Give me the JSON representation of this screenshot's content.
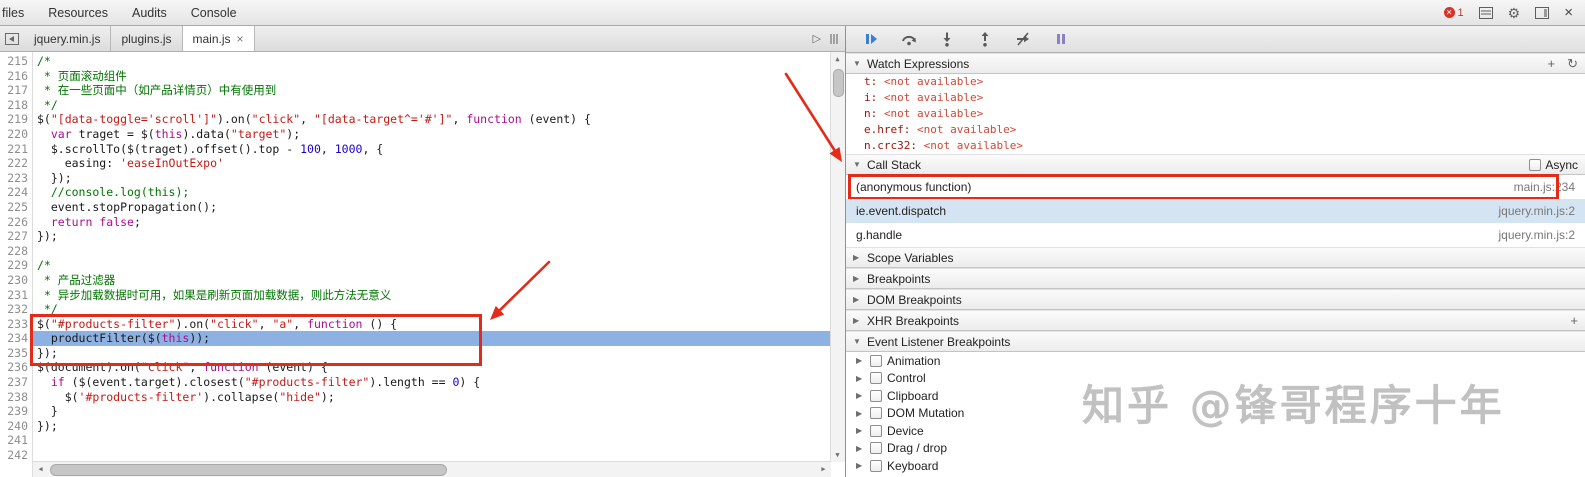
{
  "colors": {
    "annotation_red": "#e42a18",
    "execution_blue": "#8db1e3",
    "selection_blue": "#d5e4f3"
  },
  "icons": {
    "close": "×",
    "gear": "⚙",
    "refresh": "↻",
    "add": "+",
    "tri_right": "▶",
    "tri_down": "▼",
    "run": "▷",
    "err_x": "✕",
    "left": "◀",
    "right": "▶",
    "up": "▲",
    "down": "▼"
  },
  "top_bar": {
    "tabs": [
      "files",
      "Resources",
      "Audits",
      "Console"
    ],
    "error_count": "1"
  },
  "file_tab_bar": {
    "tabs": [
      {
        "label": "jquery.min.js",
        "active": false,
        "closable": false
      },
      {
        "label": "plugins.js",
        "active": false,
        "closable": false
      },
      {
        "label": "main.js",
        "active": true,
        "closable": true
      }
    ]
  },
  "editor": {
    "lines": [
      {
        "num": 215,
        "segs": [
          [
            "com",
            "/*"
          ]
        ]
      },
      {
        "num": 216,
        "segs": [
          [
            "com",
            " * 页面滚动组件"
          ]
        ]
      },
      {
        "num": 217,
        "segs": [
          [
            "com",
            " * 在一些页面中（如产品详情页）中有使用到"
          ]
        ]
      },
      {
        "num": 218,
        "segs": [
          [
            "com",
            " */"
          ]
        ]
      },
      {
        "num": 219,
        "segs": [
          [
            "pln",
            "$("
          ],
          [
            "str",
            "\"[data-toggle='scroll']\""
          ],
          [
            "pln",
            ").on("
          ],
          [
            "str",
            "\"click\""
          ],
          [
            "pln",
            ", "
          ],
          [
            "str",
            "\"[data-target^='#']\""
          ],
          [
            "pln",
            ", "
          ],
          [
            "kw",
            "function"
          ],
          [
            "pln",
            " (event) {"
          ]
        ]
      },
      {
        "num": 220,
        "segs": [
          [
            "pln",
            "  "
          ],
          [
            "kw",
            "var"
          ],
          [
            "pln",
            " traget = $("
          ],
          [
            "kw",
            "this"
          ],
          [
            "pln",
            ").data("
          ],
          [
            "str",
            "\"target\""
          ],
          [
            "pln",
            ");"
          ]
        ]
      },
      {
        "num": 221,
        "segs": [
          [
            "pln",
            "  $.scrollTo($(traget).offset().top - "
          ],
          [
            "num",
            "100"
          ],
          [
            "pln",
            ", "
          ],
          [
            "num",
            "1000"
          ],
          [
            "pln",
            ", {"
          ]
        ]
      },
      {
        "num": 222,
        "segs": [
          [
            "pln",
            "    easing: "
          ],
          [
            "str",
            "'easeInOutExpo'"
          ]
        ]
      },
      {
        "num": 223,
        "segs": [
          [
            "pln",
            "  });"
          ]
        ]
      },
      {
        "num": 224,
        "segs": [
          [
            "com",
            "  //console.log(this);"
          ]
        ]
      },
      {
        "num": 225,
        "segs": [
          [
            "pln",
            "  event.stopPropagation();"
          ]
        ]
      },
      {
        "num": 226,
        "segs": [
          [
            "pln",
            "  "
          ],
          [
            "kw",
            "return"
          ],
          [
            "pln",
            " "
          ],
          [
            "kw",
            "false"
          ],
          [
            "pln",
            ";"
          ]
        ]
      },
      {
        "num": 227,
        "segs": [
          [
            "pln",
            "});"
          ]
        ]
      },
      {
        "num": 228,
        "segs": []
      },
      {
        "num": 229,
        "segs": [
          [
            "com",
            "/*"
          ]
        ]
      },
      {
        "num": 230,
        "segs": [
          [
            "com",
            " * 产品过滤器"
          ]
        ]
      },
      {
        "num": 231,
        "segs": [
          [
            "com",
            " * 异步加载数据时可用，如果是刷新页面加载数据，则此方法无意义"
          ]
        ]
      },
      {
        "num": 232,
        "segs": [
          [
            "com",
            " */"
          ]
        ]
      },
      {
        "num": 233,
        "segs": [
          [
            "pln",
            "$("
          ],
          [
            "str",
            "\"#products-filter\""
          ],
          [
            "pln",
            ").on("
          ],
          [
            "str",
            "\"click\""
          ],
          [
            "pln",
            ", "
          ],
          [
            "str",
            "\"a\""
          ],
          [
            "pln",
            ", "
          ],
          [
            "kw",
            "function"
          ],
          [
            "pln",
            " () {"
          ]
        ]
      },
      {
        "num": 234,
        "exec": true,
        "segs": [
          [
            "pln",
            "  productFilter($("
          ],
          [
            "kw",
            "this"
          ],
          [
            "pln",
            "));"
          ]
        ]
      },
      {
        "num": 235,
        "segs": [
          [
            "pln",
            "});"
          ]
        ]
      },
      {
        "num": 236,
        "segs": [
          [
            "pln",
            "$(document).on("
          ],
          [
            "str",
            "\"click\""
          ],
          [
            "pln",
            ", "
          ],
          [
            "kw",
            "function"
          ],
          [
            "pln",
            " (event) {"
          ]
        ]
      },
      {
        "num": 237,
        "segs": [
          [
            "pln",
            "  "
          ],
          [
            "kw",
            "if"
          ],
          [
            "pln",
            " ($(event.target).closest("
          ],
          [
            "str",
            "\"#products-filter\""
          ],
          [
            "pln",
            ").length == "
          ],
          [
            "num",
            "0"
          ],
          [
            "pln",
            ") {"
          ]
        ]
      },
      {
        "num": 238,
        "segs": [
          [
            "pln",
            "    $("
          ],
          [
            "str",
            "'#products-filter'"
          ],
          [
            "pln",
            ").collapse("
          ],
          [
            "str",
            "\"hide\""
          ],
          [
            "pln",
            ");"
          ]
        ]
      },
      {
        "num": 239,
        "segs": [
          [
            "pln",
            "  }"
          ]
        ]
      },
      {
        "num": 240,
        "segs": [
          [
            "pln",
            "});"
          ]
        ]
      },
      {
        "num": 241,
        "segs": []
      },
      {
        "num": 242,
        "segs": []
      }
    ]
  },
  "sidebar": {
    "watch": {
      "title": "Watch Expressions",
      "items": [
        {
          "name": "t",
          "value": "<not available>"
        },
        {
          "name": "i",
          "value": "<not available>"
        },
        {
          "name": "n",
          "value": "<not available>"
        },
        {
          "name": "e.href",
          "value": "<not available>"
        },
        {
          "name": "n.crc32",
          "value": "<not available>"
        }
      ]
    },
    "call_stack": {
      "title": "Call Stack",
      "async_label": "Async",
      "frames": [
        {
          "fn": "(anonymous function)",
          "loc": "main.js:234",
          "annotated": true
        },
        {
          "fn": "ie.event.dispatch",
          "loc": "jquery.min.js:2",
          "selected": true
        },
        {
          "fn": "g.handle",
          "loc": "jquery.min.js:2"
        }
      ]
    },
    "sections": [
      {
        "label": "Scope Variables",
        "has_add": false
      },
      {
        "label": "Breakpoints",
        "has_add": false
      },
      {
        "label": "DOM Breakpoints",
        "has_add": false
      },
      {
        "label": "XHR Breakpoints",
        "has_add": true
      }
    ],
    "event_listener_breakpoints": {
      "title": "Event Listener Breakpoints",
      "items": [
        "Animation",
        "Control",
        "Clipboard",
        "DOM Mutation",
        "Device",
        "Drag / drop",
        "Keyboard"
      ]
    }
  },
  "watermark": "知乎 @锋哥程序十年"
}
